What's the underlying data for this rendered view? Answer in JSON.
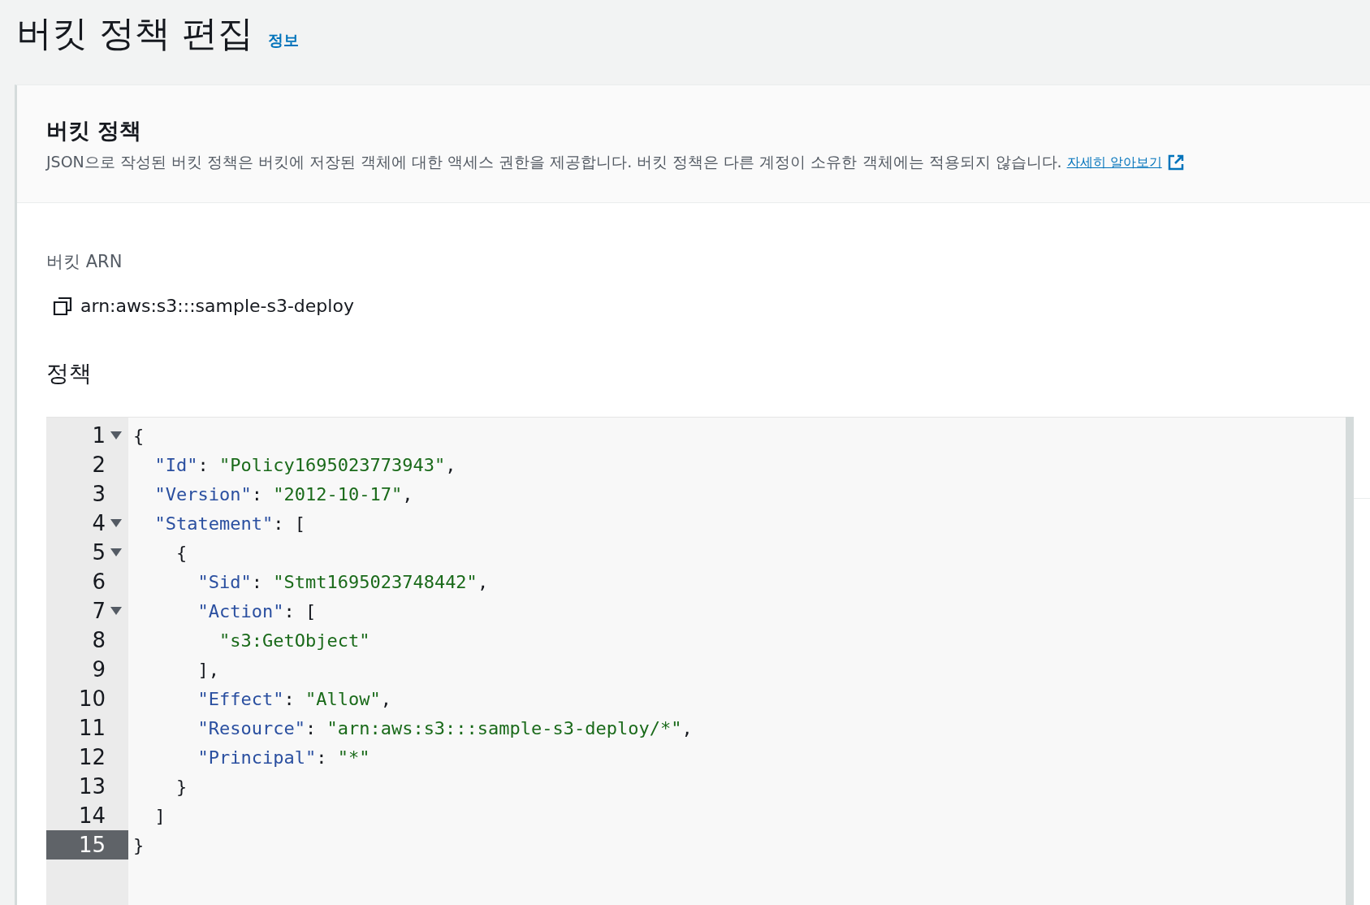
{
  "page": {
    "title": "버킷 정책 편집",
    "info_link": "정보"
  },
  "section": {
    "title": "버킷 정책",
    "description": "JSON으로 작성된 버킷 정책은 버킷에 저장된 객체에 대한 액세스 권한을 제공합니다. 버킷 정책은 다른 계정이 소유한 객체에는 적용되지 않습니다.",
    "learn_more": "자세히 알아보기"
  },
  "arn": {
    "label": "버킷 ARN",
    "value": "arn:aws:s3:::sample-s3-deploy"
  },
  "policy": {
    "label": "정책",
    "lines": [
      {
        "number": "1",
        "foldable": true,
        "active": false,
        "tokens": [
          {
            "kind": "punct",
            "text": "{"
          }
        ]
      },
      {
        "number": "2",
        "foldable": false,
        "active": false,
        "tokens": [
          {
            "kind": "key",
            "text": "  \"Id\""
          },
          {
            "kind": "punct",
            "text": ": "
          },
          {
            "kind": "string",
            "text": "\"Policy1695023773943\""
          },
          {
            "kind": "punct",
            "text": ","
          }
        ]
      },
      {
        "number": "3",
        "foldable": false,
        "active": false,
        "tokens": [
          {
            "kind": "key",
            "text": "  \"Version\""
          },
          {
            "kind": "punct",
            "text": ": "
          },
          {
            "kind": "string",
            "text": "\"2012-10-17\""
          },
          {
            "kind": "punct",
            "text": ","
          }
        ]
      },
      {
        "number": "4",
        "foldable": true,
        "active": false,
        "tokens": [
          {
            "kind": "key",
            "text": "  \"Statement\""
          },
          {
            "kind": "punct",
            "text": ": ["
          }
        ]
      },
      {
        "number": "5",
        "foldable": true,
        "active": false,
        "tokens": [
          {
            "kind": "punct",
            "text": "    {"
          }
        ]
      },
      {
        "number": "6",
        "foldable": false,
        "active": false,
        "tokens": [
          {
            "kind": "key",
            "text": "      \"Sid\""
          },
          {
            "kind": "punct",
            "text": ": "
          },
          {
            "kind": "string",
            "text": "\"Stmt1695023748442\""
          },
          {
            "kind": "punct",
            "text": ","
          }
        ]
      },
      {
        "number": "7",
        "foldable": true,
        "active": false,
        "tokens": [
          {
            "kind": "key",
            "text": "      \"Action\""
          },
          {
            "kind": "punct",
            "text": ": ["
          }
        ]
      },
      {
        "number": "8",
        "foldable": false,
        "active": false,
        "tokens": [
          {
            "kind": "string",
            "text": "        \"s3:GetObject\""
          }
        ]
      },
      {
        "number": "9",
        "foldable": false,
        "active": false,
        "tokens": [
          {
            "kind": "punct",
            "text": "      ],"
          }
        ]
      },
      {
        "number": "10",
        "foldable": false,
        "active": false,
        "tokens": [
          {
            "kind": "key",
            "text": "      \"Effect\""
          },
          {
            "kind": "punct",
            "text": ": "
          },
          {
            "kind": "string",
            "text": "\"Allow\""
          },
          {
            "kind": "punct",
            "text": ","
          }
        ]
      },
      {
        "number": "11",
        "foldable": false,
        "active": false,
        "tokens": [
          {
            "kind": "key",
            "text": "      \"Resource\""
          },
          {
            "kind": "punct",
            "text": ": "
          },
          {
            "kind": "string",
            "text": "\"arn:aws:s3:::sample-s3-deploy/*\""
          },
          {
            "kind": "punct",
            "text": ","
          }
        ]
      },
      {
        "number": "12",
        "foldable": false,
        "active": false,
        "tokens": [
          {
            "kind": "key",
            "text": "      \"Principal\""
          },
          {
            "kind": "punct",
            "text": ": "
          },
          {
            "kind": "string",
            "text": "\"*\""
          }
        ]
      },
      {
        "number": "13",
        "foldable": false,
        "active": false,
        "tokens": [
          {
            "kind": "punct",
            "text": "    }"
          }
        ]
      },
      {
        "number": "14",
        "foldable": false,
        "active": false,
        "tokens": [
          {
            "kind": "punct",
            "text": "  ]"
          }
        ]
      },
      {
        "number": "15",
        "foldable": false,
        "active": true,
        "tokens": [
          {
            "kind": "punct",
            "text": "}"
          }
        ]
      }
    ]
  }
}
